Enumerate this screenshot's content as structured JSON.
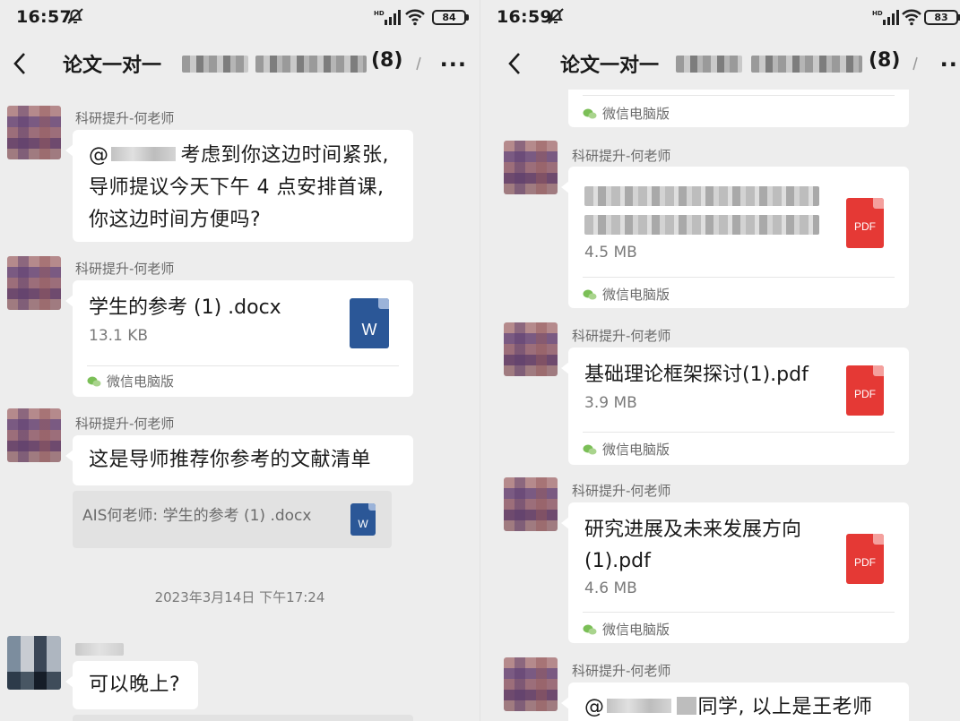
{
  "left": {
    "status": {
      "time": "16:57",
      "battery": "84"
    },
    "nav": {
      "title": "论文一对一",
      "count": "(8)"
    },
    "messages": {
      "m1": {
        "sender": "科研提升-何老师",
        "mention": "@",
        "line1": "考虑到你这边时间紧张,",
        "line2": "导师提议今天下午 4 点安排首课,",
        "line3": "你这边时间方便吗?"
      },
      "m2": {
        "sender": "科研提升-何老师",
        "file_name": "学生的参考 (1) .docx",
        "file_size": "13.1 KB",
        "source": "微信电脑版",
        "icon_letter": "W"
      },
      "m3": {
        "sender": "科研提升-何老师",
        "text": "这是导师推荐你参考的文献清单",
        "quote": "AIS何老师: 学生的参考 (1) .docx",
        "icon_letter": "W"
      },
      "timestamp": "2023年3月14日 下午17:24",
      "m4": {
        "text": "可以晚上?"
      }
    }
  },
  "right": {
    "status": {
      "time": "16:59",
      "battery": "83"
    },
    "nav": {
      "title": "论文一对一",
      "count": "(8)"
    },
    "messages": {
      "top_source": "微信电脑版",
      "r1": {
        "sender": "科研提升-何老师",
        "file_size": "4.5 MB",
        "source": "微信电脑版",
        "icon_label": "PDF"
      },
      "r2": {
        "sender": "科研提升-何老师",
        "file_name": "基础理论框架探讨(1).pdf",
        "file_size": "3.9 MB",
        "source": "微信电脑版",
        "icon_label": "PDF"
      },
      "r3": {
        "sender": "科研提升-何老师",
        "file_name_line1": "研究进展及未来发展方向",
        "file_name_line2": "(1).pdf",
        "file_size": "4.6 MB",
        "source": "微信电脑版",
        "icon_label": "PDF"
      },
      "r4": {
        "sender": "科研提升-何老师",
        "mention": "@",
        "text": "同学, 以上是王老师"
      }
    }
  }
}
